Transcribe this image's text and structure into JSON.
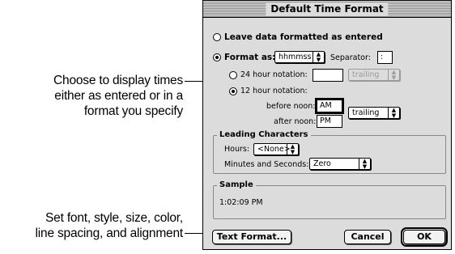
{
  "callouts": {
    "time_display": [
      "Choose to display times",
      "either as entered or in a",
      "format you specify"
    ],
    "text_format": [
      "Set font, style, size, color,",
      "line spacing, and alignment"
    ]
  },
  "dialog": {
    "title": "Default Time Format",
    "option_as_entered": "Leave data formatted as entered",
    "option_format_as": "Format as:",
    "format_value": "hhmmss",
    "separator_label": "Separator:",
    "separator_value": ":",
    "notation_24_label": "24 hour notation:",
    "notation_24_value": "",
    "notation_24_suffix": "trailing",
    "notation_12_label": "12 hour notation:",
    "before_noon_label": "before noon:",
    "before_noon_value": "AM",
    "after_noon_label": "after noon:",
    "after_noon_value": "PM",
    "suffix_12_value": "trailing",
    "leading_group_title": "Leading Characters",
    "hours_label": "Hours:",
    "hours_value": "<None>",
    "minutes_seconds_label": "Minutes and Seconds:",
    "minutes_seconds_value": "Zero",
    "sample_group_title": "Sample",
    "sample_value": "1:02:09 PM",
    "text_format_button": "Text Format...",
    "cancel_button": "Cancel",
    "ok_button": "OK"
  },
  "state": {
    "selected_mode": "format_as",
    "selected_notation": "12_hour"
  }
}
